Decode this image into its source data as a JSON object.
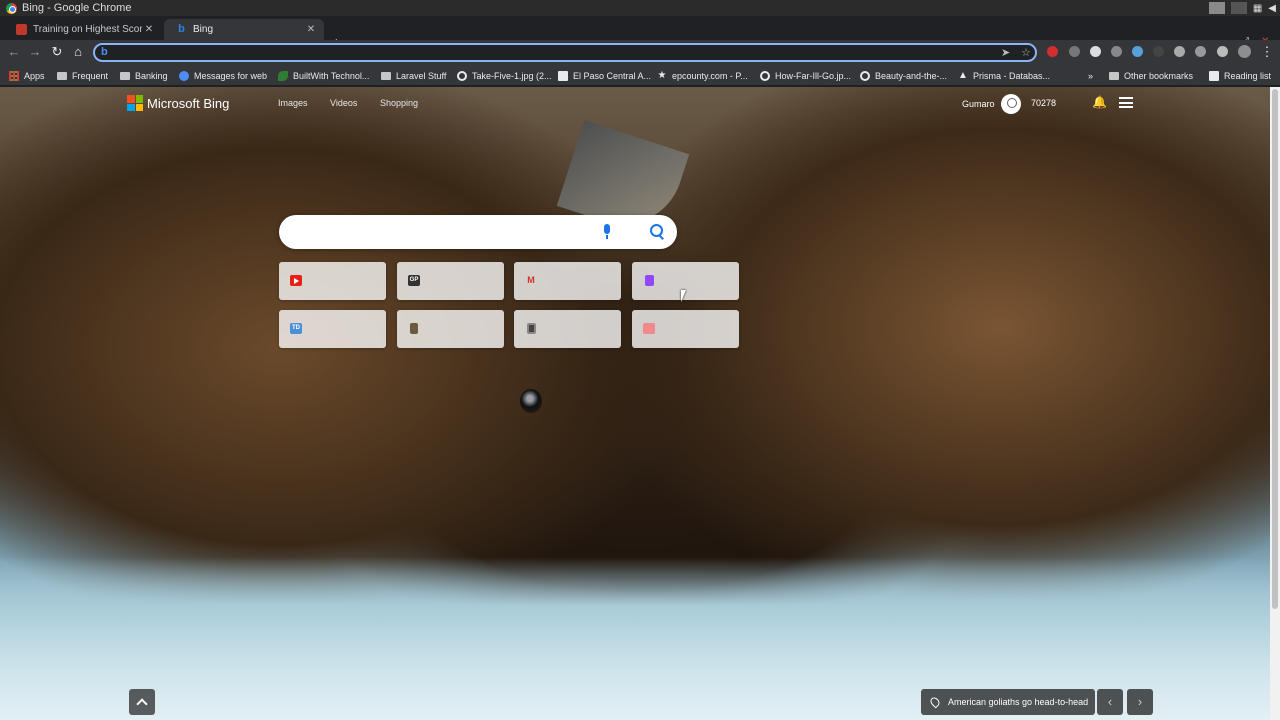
{
  "os": {
    "window_title": "Bing - Google Chrome"
  },
  "tabs": [
    {
      "title": "Training on Highest Scoring"
    },
    {
      "title": "Bing"
    }
  ],
  "omnibox": {
    "value": ""
  },
  "bookmarks": {
    "items": [
      {
        "label": "Apps",
        "icon": "apps-grid-icon"
      },
      {
        "label": "Frequent",
        "icon": "folder-icon"
      },
      {
        "label": "Banking",
        "icon": "folder-icon"
      },
      {
        "label": "Messages for web",
        "icon": "messages-icon"
      },
      {
        "label": "BuiltWith Technol...",
        "icon": "builtwith-icon"
      },
      {
        "label": "Laravel Stuff",
        "icon": "folder-icon"
      },
      {
        "label": "Take-Five-1.jpg (2...",
        "icon": "globe-icon"
      },
      {
        "label": "El Paso Central A...",
        "icon": "page-icon"
      },
      {
        "label": "epcounty.com - P...",
        "icon": "star-icon"
      },
      {
        "label": "How-Far-Ill-Go.jp...",
        "icon": "globe-icon"
      },
      {
        "label": "Beauty-and-the-...",
        "icon": "globe-icon"
      },
      {
        "label": "Prisma - Databas...",
        "icon": "prisma-icon"
      }
    ],
    "other": "Other bookmarks",
    "reading_list": "Reading list"
  },
  "bing": {
    "logo_text": "Microsoft Bing",
    "nav": [
      "Images",
      "Videos",
      "Shopping"
    ],
    "user_name": "Gumaro",
    "points": "70278",
    "search_value": "",
    "tiles": [
      {
        "icon": "youtube-icon"
      },
      {
        "icon": "gp-icon",
        "glyph": "GP"
      },
      {
        "icon": "gmail-icon",
        "glyph": "M"
      },
      {
        "icon": "twitch-icon"
      },
      {
        "icon": "td-icon",
        "glyph": "TD"
      },
      {
        "icon": "github-icon"
      },
      {
        "icon": "app-icon"
      },
      {
        "icon": "pink-site-icon"
      }
    ],
    "caption": "American goliaths go head-to-head"
  }
}
